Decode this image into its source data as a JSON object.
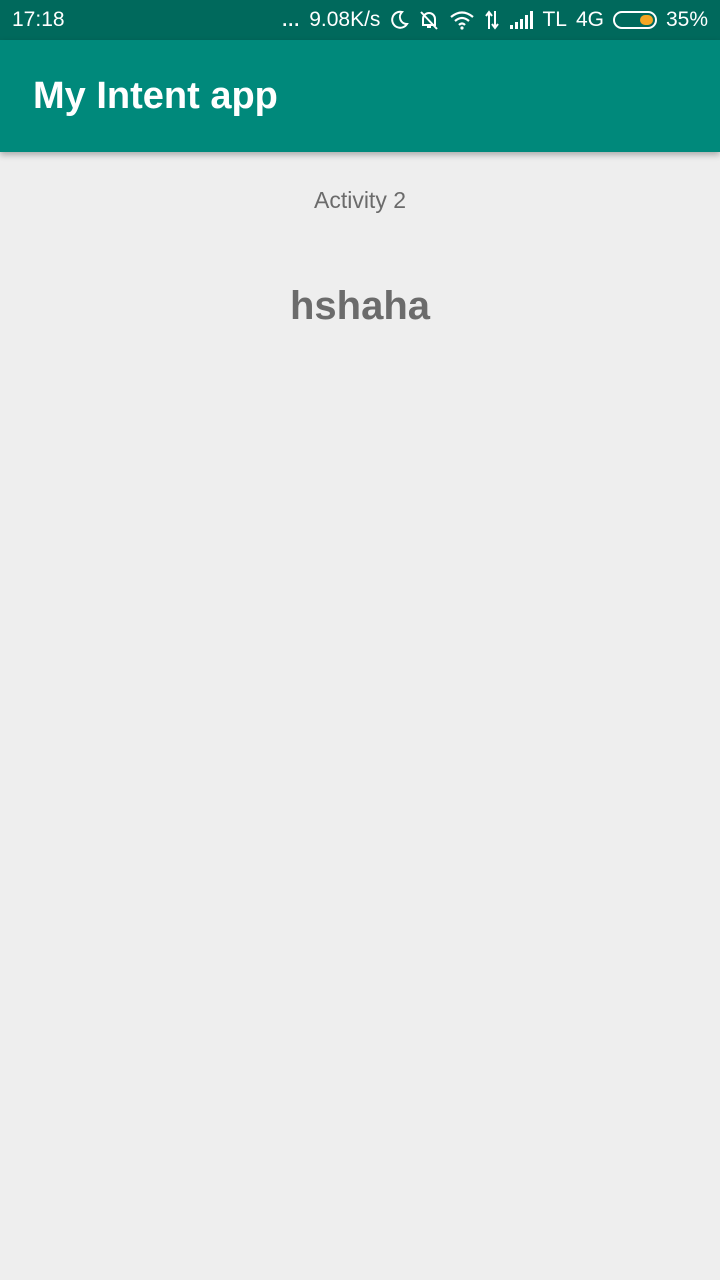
{
  "status_bar": {
    "time": "17:18",
    "dots": "...",
    "network_speed": "9.08K/s",
    "carrier": "TL",
    "network_type": "4G",
    "battery_percent": "35%",
    "battery_level": 0.35,
    "battery_color": "#f5a623",
    "icons": [
      "moon-icon",
      "bell-off-icon",
      "wifi-icon",
      "data-arrows-icon",
      "signal-icon"
    ]
  },
  "app_bar": {
    "title": "My Intent app",
    "color": "#00897b"
  },
  "content": {
    "activity_label": "Activity 2",
    "message": "hshaha"
  }
}
